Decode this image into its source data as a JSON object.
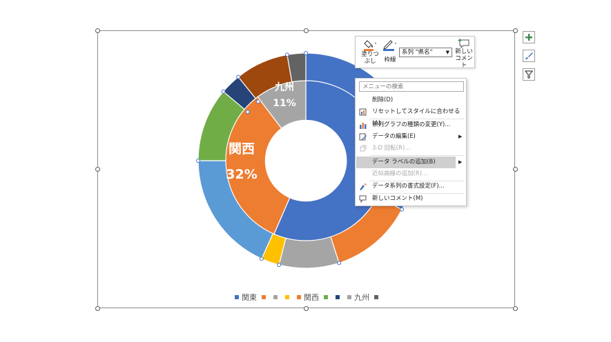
{
  "chart": {
    "segment_labels": [
      {
        "id": "kyushu-name",
        "text": "九州"
      },
      {
        "id": "kyushu-pct",
        "text": "11%"
      },
      {
        "id": "kansai-name",
        "text": "関西"
      },
      {
        "id": "kansai-pct",
        "text": "32%"
      }
    ]
  },
  "legend": {
    "entries": [
      {
        "label": "関東",
        "color": "#4472C4"
      },
      {
        "label": "",
        "color": "#ED7D31"
      },
      {
        "label": "",
        "color": "#A5A5A5"
      },
      {
        "label": "",
        "color": "#FFC000"
      },
      {
        "label": "関西",
        "color": "#ED7D31"
      },
      {
        "label": "",
        "color": "#70AD47"
      },
      {
        "label": "",
        "color": "#264478"
      },
      {
        "label": "九州",
        "color": "#A5A5A5"
      },
      {
        "label": "",
        "color": "#636363"
      }
    ]
  },
  "mini_toolbar": {
    "fill_label": "塗りつぶし",
    "outline_label": "枠線",
    "series_select_value": "系列 \"県名\"",
    "new_comment_label": "新しいコメント"
  },
  "context_menu": {
    "search_placeholder": "メニューの検索",
    "items": [
      {
        "label": "削除(D)",
        "icon": "delete",
        "enabled": true
      },
      {
        "label": "リセットしてスタイルに合わせる(A)",
        "icon": "reset-style-icon",
        "enabled": true
      },
      {
        "label": "系列グラフの種類の変更(Y)...",
        "icon": "chart-type-icon",
        "enabled": true
      },
      {
        "label": "データの編集(E)",
        "icon": "edit-data-icon",
        "enabled": true,
        "submenu": true
      },
      {
        "label": "3-D 回転(R)...",
        "icon": "rotate-3d-icon",
        "enabled": false
      },
      {
        "label": "データ ラベルの追加(B)",
        "icon": "",
        "enabled": true,
        "submenu": true,
        "highlighted": true
      },
      {
        "label": "近似曲線の追加(R)...",
        "icon": "",
        "enabled": false
      },
      {
        "label": "データ系列の書式設定(F)...",
        "icon": "format-series-icon",
        "enabled": true
      },
      {
        "label": "新しいコメント(M)",
        "icon": "comment-icon",
        "enabled": true
      }
    ]
  },
  "colors": {
    "blue": "#4472C4",
    "orange": "#ED7D31",
    "gray": "#A5A5A5",
    "gold": "#FFC000",
    "green": "#70AD47",
    "navy": "#264478",
    "brown": "#9E480E",
    "darkgray": "#636363",
    "light_blue": "#5B9BD5"
  }
}
